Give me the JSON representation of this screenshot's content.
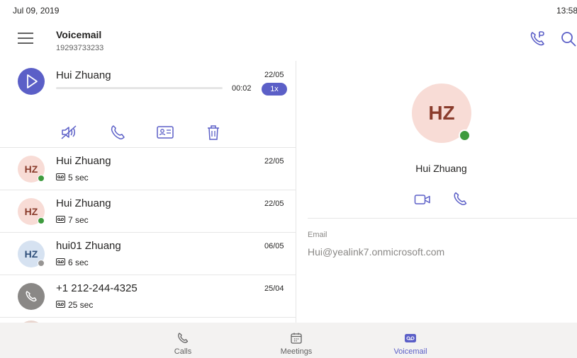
{
  "status_bar": {
    "date": "Jul 09, 2019",
    "time": "13:58"
  },
  "header": {
    "title": "Voicemail",
    "subtitle": "19293733233",
    "icons": [
      "menu-icon",
      "call-park-icon",
      "search-icon"
    ]
  },
  "colors": {
    "accent": "#5b5fc7",
    "presence_available": "#3e9b3e",
    "presence_offline": "#979593"
  },
  "expanded_item": {
    "name": "Hui Zhuang",
    "date": "22/05",
    "duration": "00:02",
    "speed": "1x",
    "progress": 0.0,
    "actions": [
      "mute-speaker-icon",
      "call-icon",
      "contact-card-icon",
      "delete-icon"
    ]
  },
  "voicemails": [
    {
      "initials": "HZ",
      "name": "Hui Zhuang",
      "date": "22/05",
      "duration": "5 sec",
      "presence": "available"
    },
    {
      "initials": "HZ",
      "name": "Hui Zhuang",
      "date": "22/05",
      "duration": "7 sec",
      "presence": "available"
    },
    {
      "initials": "HZ",
      "name": "hui01 Zhuang",
      "date": "06/05",
      "duration": "6 sec",
      "presence": "offline"
    },
    {
      "initials": "",
      "name": "+1 212-244-4325",
      "date": "25/04",
      "duration": "25 sec",
      "presence": "none"
    }
  ],
  "detail": {
    "initials": "HZ",
    "name": "Hui Zhuang",
    "email_label": "Email",
    "email": "Hui@yealink7.onmicrosoft.com"
  },
  "nav": [
    {
      "label": "Calls",
      "icon": "phone-icon",
      "active": false
    },
    {
      "label": "Meetings",
      "icon": "calendar-icon",
      "active": false
    },
    {
      "label": "Voicemail",
      "icon": "voicemail-icon",
      "active": true
    }
  ]
}
